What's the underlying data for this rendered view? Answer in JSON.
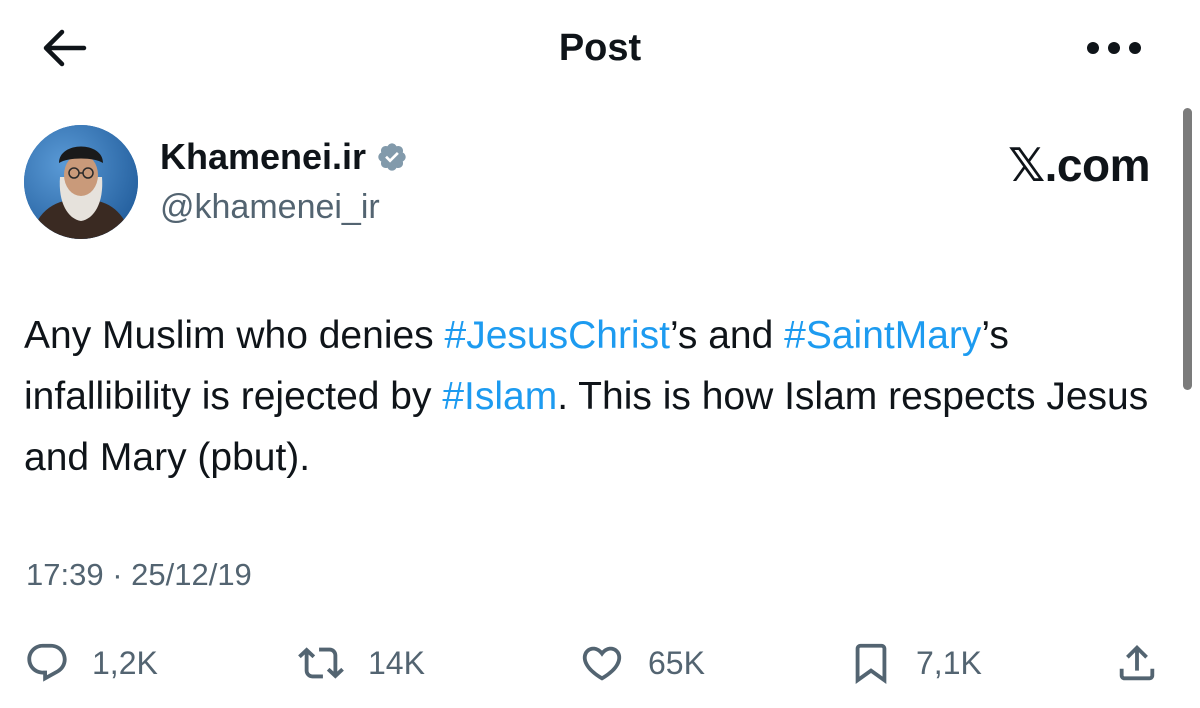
{
  "header": {
    "title": "Post",
    "back_icon": "arrow-left-icon",
    "more_icon": "more-horizontal-icon"
  },
  "author": {
    "display_name": "Khamenei.ir",
    "handle": "@khamenei_ir",
    "verified_icon": "verified-badge-icon",
    "verified_color": "#829aab"
  },
  "watermark": "𝕏.com",
  "tweet": {
    "segments": [
      {
        "text": "Any Muslim who denies ",
        "hashtag": false
      },
      {
        "text": "#JesusChrist",
        "hashtag": true
      },
      {
        "text": "’s and ",
        "hashtag": false
      },
      {
        "text": "#SaintMary",
        "hashtag": true
      },
      {
        "text": "’s infallibility is rejected by ",
        "hashtag": false
      },
      {
        "text": "#Islam",
        "hashtag": true
      },
      {
        "text": ". This is how Islam respects Jesus and Mary (pbut).",
        "hashtag": false
      }
    ],
    "timestamp": "17:39 · 25/12/19"
  },
  "actions": {
    "reply": {
      "icon": "reply-icon",
      "count": "1,2K"
    },
    "repost": {
      "icon": "repost-icon",
      "count": "14K"
    },
    "like": {
      "icon": "heart-icon",
      "count": "65K"
    },
    "bookmark": {
      "icon": "bookmark-icon",
      "count": "7,1K"
    },
    "share": {
      "icon": "share-icon"
    }
  },
  "colors": {
    "text": "#0f1419",
    "secondary": "#536471",
    "link": "#1d9bf0"
  }
}
